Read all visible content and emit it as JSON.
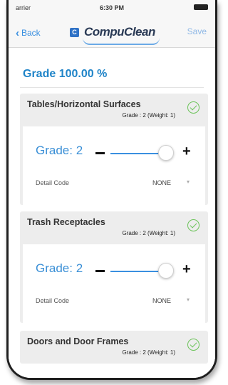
{
  "status_bar": {
    "carrier": "arrier",
    "time": "6:30 PM"
  },
  "nav": {
    "back_label": "Back",
    "save_label": "Save",
    "logo_text": "CompuClean",
    "logo_mark": "C"
  },
  "page": {
    "grade_title": "Grade 100.00 %"
  },
  "sections": [
    {
      "title": "Tables/Horizontal Surfaces",
      "subtitle": "Grade : 2 (Weight: 1)",
      "grade_label": "Grade: 2",
      "grade_value": 2,
      "detail_label": "Detail Code",
      "detail_value": "NONE"
    },
    {
      "title": "Trash Receptacles",
      "subtitle": "Grade : 2 (Weight: 1)",
      "grade_label": "Grade: 2",
      "grade_value": 2,
      "detail_label": "Detail Code",
      "detail_value": "NONE"
    },
    {
      "title": "Doors and Door Frames",
      "subtitle": "Grade : 2 (Weight: 1)"
    }
  ],
  "icons": {
    "back": "chevron-left-icon",
    "check": "check-circle-icon",
    "select": "chevron-down-icon"
  },
  "colors": {
    "accent": "#3a8fe0",
    "grade_title": "#1f84c8",
    "check": "#6cc35a",
    "section_bg": "#ededed"
  }
}
